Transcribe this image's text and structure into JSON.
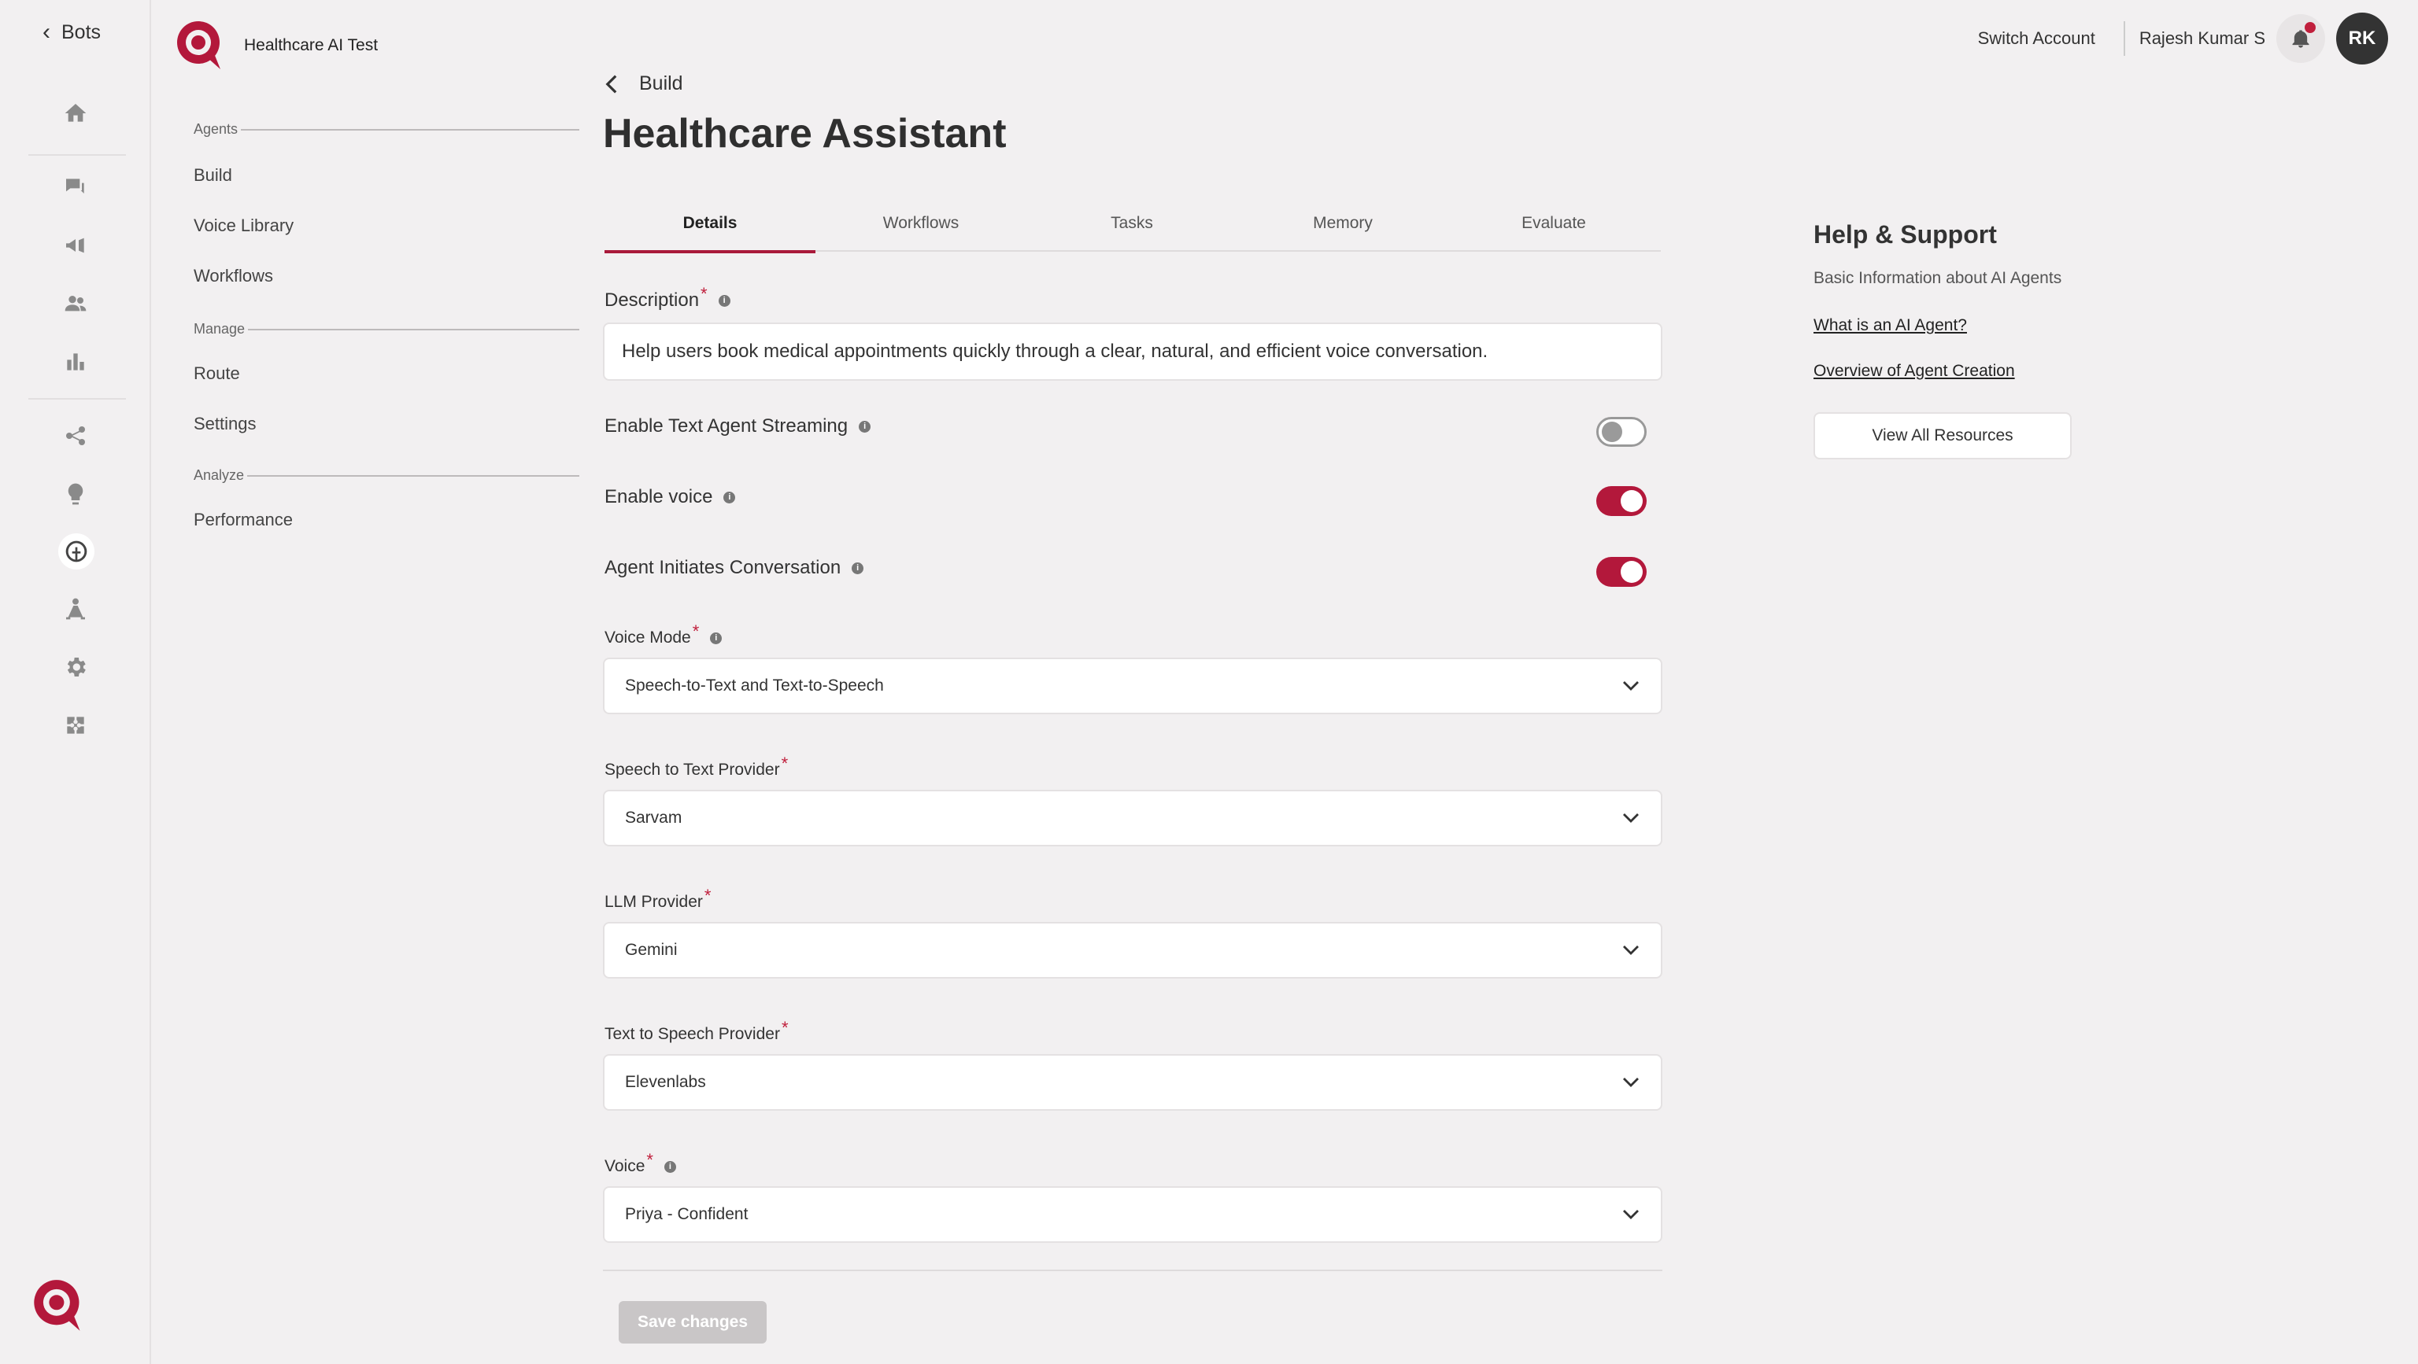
{
  "rail": {
    "back_label": "Bots",
    "icons": [
      "home-icon",
      "chat-icon",
      "megaphone-icon",
      "users-icon",
      "bar-chart-icon",
      "nodes-icon",
      "lightbulb-icon",
      "brain-icon",
      "hierarchy-icon",
      "gear-icon",
      "puzzle-icon"
    ]
  },
  "sidebar": {
    "app_name": "Healthcare AI Test",
    "sections": [
      {
        "heading": "Agents",
        "items": [
          "Build",
          "Voice Library",
          "Workflows"
        ]
      },
      {
        "heading": "Manage",
        "items": [
          "Route",
          "Settings"
        ]
      },
      {
        "heading": "Analyze",
        "items": [
          "Performance"
        ]
      }
    ]
  },
  "topbar": {
    "switch_account": "Switch Account",
    "user_name": "Rajesh Kumar S",
    "avatar_initials": "RK"
  },
  "main": {
    "breadcrumb": "Build",
    "title": "Healthcare Assistant",
    "tabs": [
      "Details",
      "Workflows",
      "Tasks",
      "Memory",
      "Evaluate"
    ],
    "active_tab": "Details",
    "description_label": "Description",
    "description_value": "Help users book medical appointments quickly through a clear, natural, and efficient voice conversation.",
    "toggles": [
      {
        "label": "Enable Text Agent Streaming",
        "on": false
      },
      {
        "label": "Enable voice",
        "on": true
      },
      {
        "label": "Agent Initiates Conversation",
        "on": true
      }
    ],
    "selects": [
      {
        "label": "Voice Mode",
        "value": "Speech-to-Text and Text-to-Speech"
      },
      {
        "label": "Speech to Text Provider",
        "value": "Sarvam"
      },
      {
        "label": "LLM Provider",
        "value": "Gemini"
      },
      {
        "label": "Text to Speech Provider",
        "value": "Elevenlabs"
      },
      {
        "label": "Voice",
        "value": "Priya - Confident"
      }
    ],
    "save_label": "Save changes",
    "required_mark": "*",
    "info_mark": "i"
  },
  "help": {
    "title": "Help & Support",
    "subtitle": "Basic Information about AI Agents",
    "links": [
      "What is an AI Agent?",
      "Overview of Agent Creation"
    ],
    "button": "View All Resources"
  },
  "colors": {
    "accent": "#b3183b",
    "background": "#f2f0f1"
  }
}
